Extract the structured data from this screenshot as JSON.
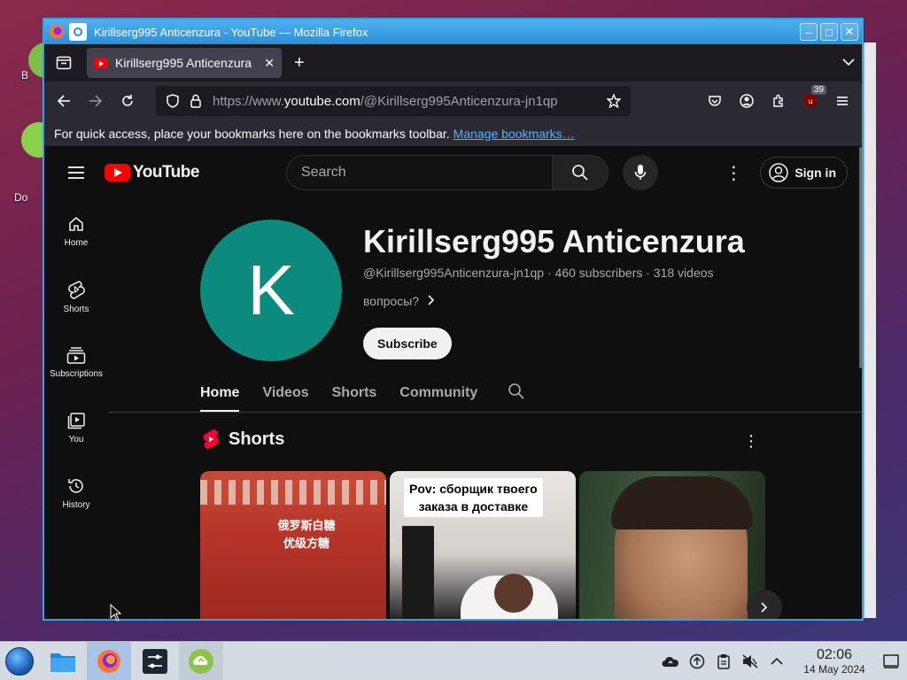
{
  "desktop": {
    "label_1": "B",
    "label_2": "Do"
  },
  "window": {
    "title": "Kirillserg995 Anticenzura - YouTube — Mozilla Firefox"
  },
  "browser": {
    "tab_title": "Kirillserg995 Anticenzura",
    "url_prefix": "https://www.",
    "url_host": "youtube.com",
    "url_path": "/@Kirillserg995Anticenzura-jn1qp",
    "extension_badge": "39",
    "bookmarks_hint": "For quick access, place your bookmarks here on the bookmarks toolbar.",
    "manage_bookmarks": "Manage bookmarks…"
  },
  "youtube": {
    "logo_text": "YouTube",
    "search_placeholder": "Search",
    "sign_in": "Sign in",
    "guide": [
      {
        "label": "Home",
        "icon": "home-icon"
      },
      {
        "label": "Shorts",
        "icon": "shorts-icon"
      },
      {
        "label": "Subscriptions",
        "icon": "subscriptions-icon"
      },
      {
        "label": "You",
        "icon": "you-icon"
      },
      {
        "label": "History",
        "icon": "history-icon"
      }
    ],
    "channel": {
      "avatar_letter": "K",
      "avatar_color": "#0b8a7d",
      "name": "Kirillserg995 Anticenzura",
      "meta": "@Kirillserg995Anticenzura-jn1qp · 460 subscribers · 318 videos",
      "description": "вопросы?",
      "subscribe": "Subscribe"
    },
    "tabs": [
      "Home",
      "Videos",
      "Shorts",
      "Community"
    ],
    "active_tab": "Home",
    "shorts_heading": "Shorts",
    "short_2_caption_line1": "Pov: сборщик твоего",
    "short_2_caption_line2": "заказа в доставке",
    "short_1_text_line1": "俄罗斯白糖",
    "short_1_text_line2": "优级方糖"
  },
  "taskbar": {
    "time": "02:06",
    "date": "14 May 2024"
  }
}
